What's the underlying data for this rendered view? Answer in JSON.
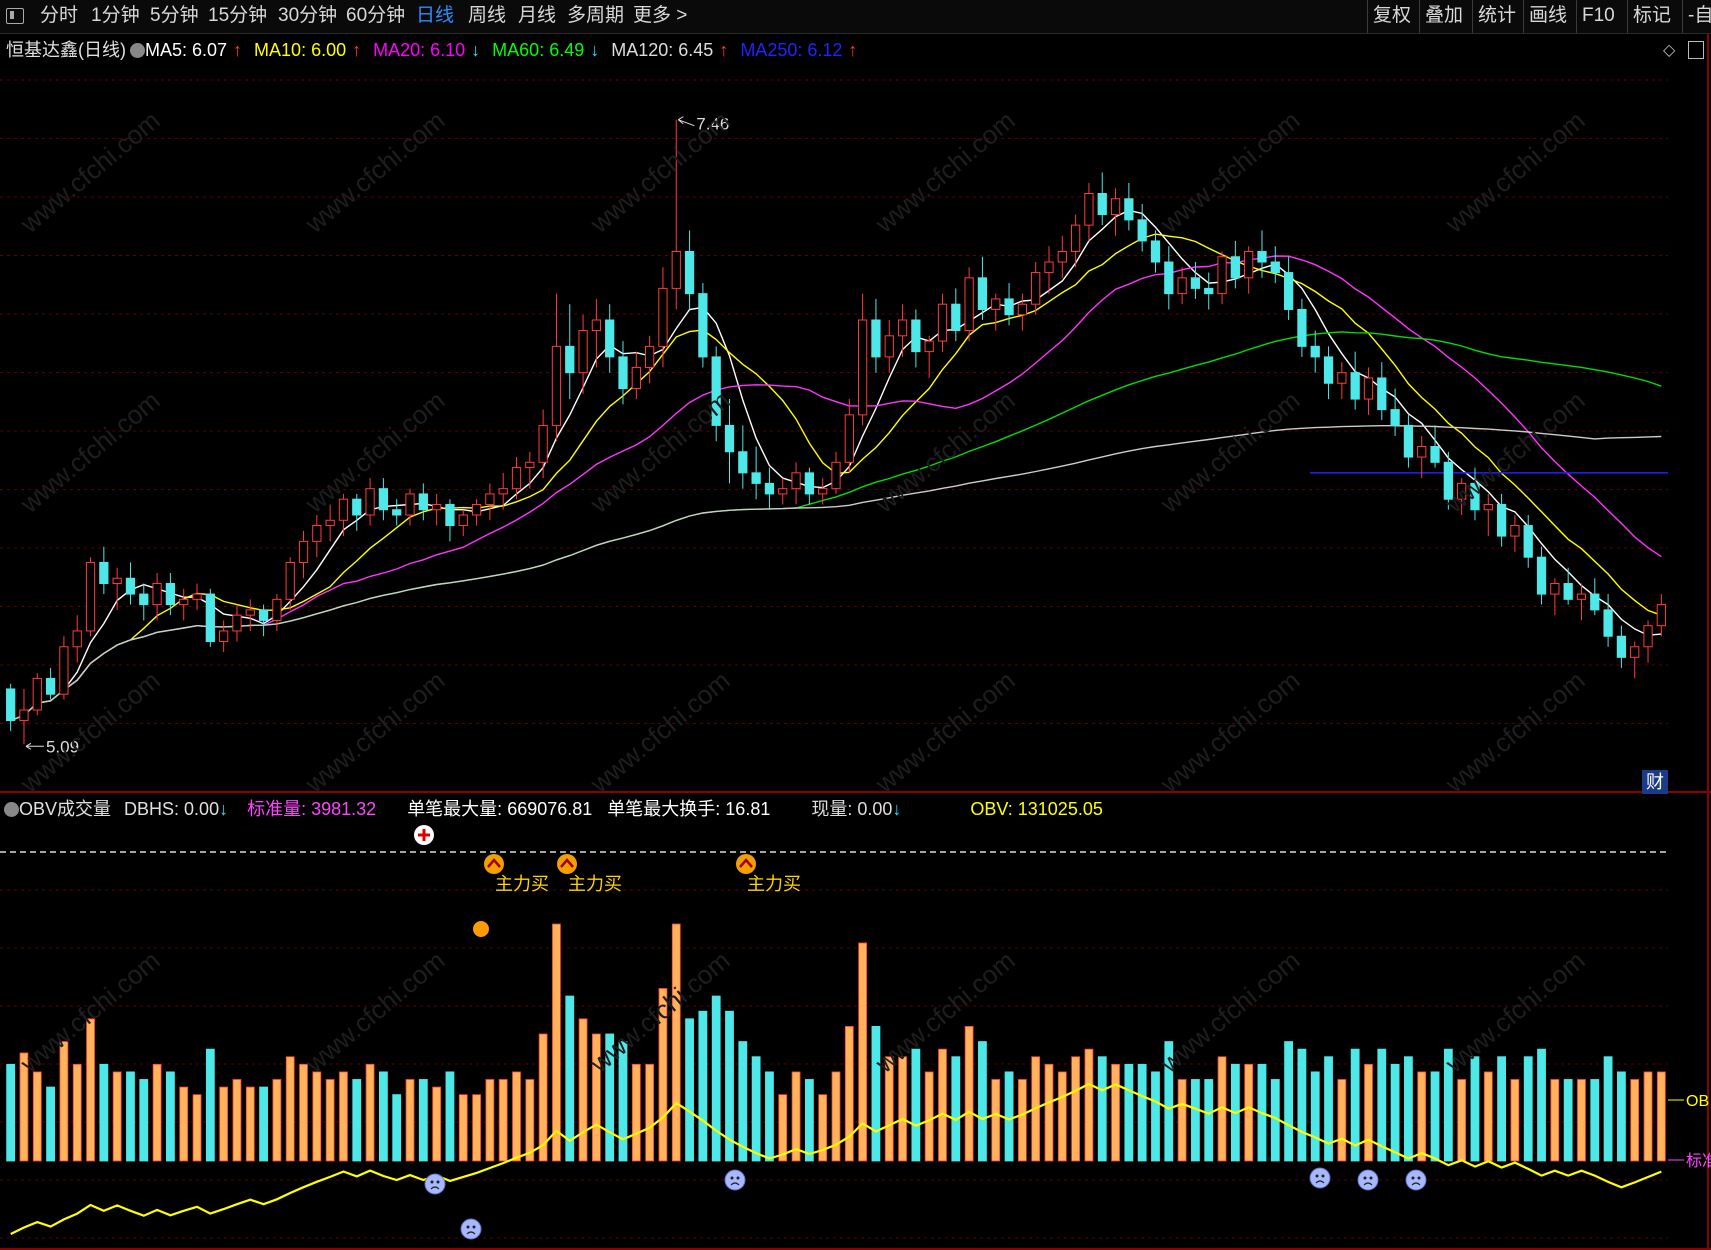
{
  "toolbar": {
    "periods": [
      "分时",
      "1分钟",
      "5分钟",
      "15分钟",
      "30分钟",
      "60分钟",
      "日线",
      "周线",
      "月线",
      "多周期",
      "更多 >"
    ],
    "active_period": "日线",
    "right_buttons": [
      "复权",
      "叠加",
      "统计",
      "画线",
      "F10",
      "标记",
      "-自"
    ]
  },
  "main_legend": {
    "title": "恒基达鑫(日线)",
    "ma": [
      {
        "label": "MA5: 6.07",
        "arrow": "↑",
        "color": "#ffffff",
        "arrow_dir": "up"
      },
      {
        "label": "MA10: 6.00",
        "arrow": "↑",
        "color": "#ffff00",
        "arrow_dir": "up"
      },
      {
        "label": "MA20: 6.10",
        "arrow": "↓",
        "color": "#ff00ff",
        "arrow_dir": "down"
      },
      {
        "label": "MA60: 6.49",
        "arrow": "↓",
        "color": "#00ff00",
        "arrow_dir": "down"
      },
      {
        "label": "MA120: 6.45",
        "arrow": "↑",
        "color": "#dddddd",
        "arrow_dir": "up"
      },
      {
        "label": "MA250: 6.12",
        "arrow": "↑",
        "color": "#2222ff",
        "arrow_dir": "up"
      }
    ],
    "high_label": "7.46",
    "low_label": "5.09"
  },
  "sub_legend": {
    "title": "OBV成交量",
    "dbhs": "DBHS: 0.00",
    "dbhs_arrow": "↓",
    "std_vol": "标准量: 3981.32",
    "max_single": "单笔最大量: 669076.81",
    "max_turnover": "单笔最大换手: 16.81",
    "now_vol": "现量: 0.00",
    "now_arrow": "↓",
    "obv": "OBV: 131025.05",
    "right_tag_obv": "OB",
    "right_tag_std": "标准",
    "signal_text": "主力买"
  },
  "badge": "财",
  "colors": {
    "up": "#ff3b3b",
    "down": "#4ee8e8",
    "vol_up": "#ffb35a",
    "grid": "#5a0000",
    "obv": "#ffff00"
  },
  "chart_data": {
    "type": "candlestick",
    "title": "恒基达鑫(日线)",
    "price_range": [
      5.09,
      7.46
    ],
    "ohlc": [
      [
        5.3,
        5.32,
        5.14,
        5.18
      ],
      [
        5.18,
        5.3,
        5.09,
        5.22
      ],
      [
        5.22,
        5.36,
        5.2,
        5.34
      ],
      [
        5.34,
        5.38,
        5.26,
        5.28
      ],
      [
        5.28,
        5.5,
        5.26,
        5.46
      ],
      [
        5.46,
        5.58,
        5.4,
        5.52
      ],
      [
        5.52,
        5.8,
        5.5,
        5.78
      ],
      [
        5.78,
        5.84,
        5.66,
        5.7
      ],
      [
        5.7,
        5.76,
        5.6,
        5.72
      ],
      [
        5.72,
        5.78,
        5.62,
        5.66
      ],
      [
        5.66,
        5.7,
        5.56,
        5.62
      ],
      [
        5.62,
        5.74,
        5.56,
        5.7
      ],
      [
        5.7,
        5.74,
        5.58,
        5.62
      ],
      [
        5.62,
        5.68,
        5.56,
        5.64
      ],
      [
        5.64,
        5.7,
        5.6,
        5.66
      ],
      [
        5.66,
        5.68,
        5.46,
        5.48
      ],
      [
        5.48,
        5.56,
        5.44,
        5.52
      ],
      [
        5.52,
        5.62,
        5.48,
        5.58
      ],
      [
        5.58,
        5.64,
        5.52,
        5.6
      ],
      [
        5.6,
        5.62,
        5.5,
        5.56
      ],
      [
        5.56,
        5.66,
        5.52,
        5.64
      ],
      [
        5.64,
        5.8,
        5.6,
        5.78
      ],
      [
        5.78,
        5.9,
        5.72,
        5.86
      ],
      [
        5.86,
        5.96,
        5.8,
        5.92
      ],
      [
        5.92,
        6.0,
        5.86,
        5.94
      ],
      [
        5.94,
        6.04,
        5.88,
        6.02
      ],
      [
        6.02,
        6.04,
        5.9,
        5.96
      ],
      [
        5.96,
        6.1,
        5.92,
        6.06
      ],
      [
        6.06,
        6.1,
        5.94,
        5.98
      ],
      [
        5.98,
        6.02,
        5.92,
        5.96
      ],
      [
        5.96,
        6.06,
        5.92,
        6.04
      ],
      [
        6.04,
        6.08,
        5.94,
        5.98
      ],
      [
        5.98,
        6.04,
        5.92,
        6.0
      ],
      [
        6.0,
        6.02,
        5.86,
        5.92
      ],
      [
        5.92,
        5.98,
        5.88,
        5.96
      ],
      [
        5.96,
        6.02,
        5.92,
        6.0
      ],
      [
        6.0,
        6.08,
        5.94,
        6.04
      ],
      [
        6.04,
        6.12,
        5.98,
        6.06
      ],
      [
        6.06,
        6.18,
        6.02,
        6.14
      ],
      [
        6.14,
        6.2,
        6.06,
        6.16
      ],
      [
        6.16,
        6.36,
        6.1,
        6.3
      ],
      [
        6.3,
        6.8,
        6.24,
        6.6
      ],
      [
        6.6,
        6.76,
        6.4,
        6.5
      ],
      [
        6.5,
        6.72,
        6.42,
        6.66
      ],
      [
        6.66,
        6.78,
        6.52,
        6.7
      ],
      [
        6.7,
        6.76,
        6.5,
        6.56
      ],
      [
        6.56,
        6.62,
        6.38,
        6.44
      ],
      [
        6.44,
        6.58,
        6.4,
        6.52
      ],
      [
        6.52,
        6.64,
        6.46,
        6.6
      ],
      [
        6.6,
        6.9,
        6.52,
        6.82
      ],
      [
        6.82,
        7.46,
        6.74,
        6.96
      ],
      [
        6.96,
        7.04,
        6.74,
        6.8
      ],
      [
        6.8,
        6.84,
        6.52,
        6.56
      ],
      [
        6.56,
        6.6,
        6.24,
        6.3
      ],
      [
        6.3,
        6.4,
        6.08,
        6.2
      ],
      [
        6.2,
        6.3,
        6.06,
        6.12
      ],
      [
        6.12,
        6.22,
        6.02,
        6.08
      ],
      [
        6.08,
        6.14,
        5.98,
        6.04
      ],
      [
        6.04,
        6.1,
        6.0,
        6.06
      ],
      [
        6.06,
        6.16,
        6.0,
        6.12
      ],
      [
        6.12,
        6.14,
        6.0,
        6.04
      ],
      [
        6.04,
        6.1,
        6.0,
        6.06
      ],
      [
        6.06,
        6.2,
        6.04,
        6.16
      ],
      [
        6.16,
        6.4,
        6.12,
        6.34
      ],
      [
        6.34,
        6.8,
        6.3,
        6.7
      ],
      [
        6.7,
        6.78,
        6.5,
        6.56
      ],
      [
        6.56,
        6.7,
        6.5,
        6.64
      ],
      [
        6.64,
        6.76,
        6.56,
        6.7
      ],
      [
        6.7,
        6.74,
        6.52,
        6.58
      ],
      [
        6.58,
        6.64,
        6.48,
        6.62
      ],
      [
        6.62,
        6.8,
        6.58,
        6.76
      ],
      [
        6.76,
        6.82,
        6.62,
        6.66
      ],
      [
        6.66,
        6.9,
        6.62,
        6.86
      ],
      [
        6.86,
        6.94,
        6.7,
        6.74
      ],
      [
        6.74,
        6.8,
        6.66,
        6.78
      ],
      [
        6.78,
        6.84,
        6.68,
        6.72
      ],
      [
        6.72,
        6.8,
        6.66,
        6.76
      ],
      [
        6.76,
        6.92,
        6.72,
        6.88
      ],
      [
        6.88,
        6.98,
        6.8,
        6.92
      ],
      [
        6.92,
        7.02,
        6.86,
        6.96
      ],
      [
        6.96,
        7.1,
        6.9,
        7.06
      ],
      [
        7.06,
        7.22,
        7.0,
        7.18
      ],
      [
        7.18,
        7.26,
        7.06,
        7.1
      ],
      [
        7.1,
        7.2,
        7.02,
        7.16
      ],
      [
        7.16,
        7.22,
        7.04,
        7.08
      ],
      [
        7.08,
        7.14,
        6.96,
        7.0
      ],
      [
        7.0,
        7.04,
        6.88,
        6.92
      ],
      [
        6.92,
        6.98,
        6.74,
        6.8
      ],
      [
        6.8,
        6.9,
        6.76,
        6.86
      ],
      [
        6.86,
        6.92,
        6.78,
        6.82
      ],
      [
        6.82,
        6.88,
        6.74,
        6.8
      ],
      [
        6.8,
        6.96,
        6.76,
        6.94
      ],
      [
        6.94,
        7.0,
        6.82,
        6.86
      ],
      [
        6.86,
        6.98,
        6.8,
        6.96
      ],
      [
        6.96,
        7.04,
        6.86,
        6.92
      ],
      [
        6.92,
        6.98,
        6.84,
        6.88
      ],
      [
        6.88,
        6.94,
        6.7,
        6.74
      ],
      [
        6.74,
        6.78,
        6.56,
        6.6
      ],
      [
        6.6,
        6.66,
        6.5,
        6.56
      ],
      [
        6.56,
        6.6,
        6.4,
        6.46
      ],
      [
        6.46,
        6.54,
        6.4,
        6.5
      ],
      [
        6.5,
        6.58,
        6.36,
        6.4
      ],
      [
        6.4,
        6.52,
        6.34,
        6.48
      ],
      [
        6.48,
        6.54,
        6.32,
        6.36
      ],
      [
        6.36,
        6.44,
        6.26,
        6.3
      ],
      [
        6.3,
        6.34,
        6.14,
        6.18
      ],
      [
        6.18,
        6.26,
        6.1,
        6.22
      ],
      [
        6.22,
        6.3,
        6.14,
        6.16
      ],
      [
        6.16,
        6.2,
        5.98,
        6.02
      ],
      [
        6.02,
        6.1,
        5.96,
        6.08
      ],
      [
        6.08,
        6.14,
        5.94,
        5.98
      ],
      [
        5.98,
        6.04,
        5.88,
        6.0
      ],
      [
        6.0,
        6.04,
        5.84,
        5.88
      ],
      [
        5.88,
        5.96,
        5.82,
        5.92
      ],
      [
        5.92,
        5.96,
        5.76,
        5.8
      ],
      [
        5.8,
        5.84,
        5.62,
        5.66
      ],
      [
        5.66,
        5.72,
        5.58,
        5.7
      ],
      [
        5.7,
        5.76,
        5.62,
        5.64
      ],
      [
        5.64,
        5.7,
        5.56,
        5.66
      ],
      [
        5.66,
        5.72,
        5.58,
        5.6
      ],
      [
        5.6,
        5.66,
        5.46,
        5.5
      ],
      [
        5.5,
        5.54,
        5.38,
        5.42
      ],
      [
        5.42,
        5.48,
        5.34,
        5.46
      ],
      [
        5.46,
        5.56,
        5.4,
        5.54
      ],
      [
        5.54,
        5.66,
        5.5,
        5.62
      ]
    ],
    "volume_max_label": "669076.81",
    "obv_value": 131025.05
  }
}
